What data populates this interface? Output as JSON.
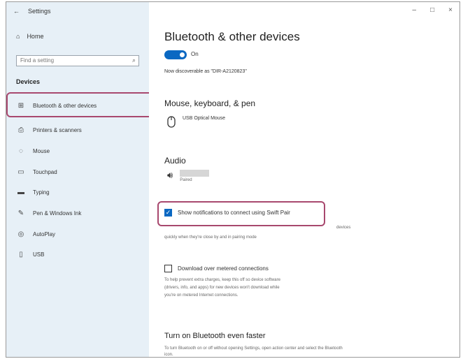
{
  "window": {
    "back_label": "←",
    "title": "Settings",
    "controls": {
      "minimize": "–",
      "maximize": "□",
      "close": "×"
    }
  },
  "sidebar": {
    "home_label": "Home",
    "search_placeholder": "Find a setting",
    "section_label": "Devices",
    "items": [
      {
        "label": "Bluetooth & other devices",
        "icon": "bluetooth-devices-icon",
        "glyph": "⊞"
      },
      {
        "label": "Printers & scanners",
        "icon": "printer-icon",
        "glyph": "⎙"
      },
      {
        "label": "Mouse",
        "icon": "mouse-icon",
        "glyph": "◌"
      },
      {
        "label": "Touchpad",
        "icon": "touchpad-icon",
        "glyph": "▭"
      },
      {
        "label": "Typing",
        "icon": "keyboard-icon",
        "glyph": "▬"
      },
      {
        "label": "Pen & Windows Ink",
        "icon": "pen-icon",
        "glyph": "✎"
      },
      {
        "label": "AutoPlay",
        "icon": "autoplay-icon",
        "glyph": "◎"
      },
      {
        "label": "USB",
        "icon": "usb-icon",
        "glyph": "▯"
      }
    ]
  },
  "main": {
    "title": "Bluetooth & other devices",
    "bluetooth_toggle": {
      "state_label": "On",
      "on": true
    },
    "discoverable_text": "Now discoverable as \"DIR-A2120823\"",
    "mouse_section": {
      "heading": "Mouse, keyboard, & pen",
      "device_name": "USB Optical Mouse"
    },
    "audio_section": {
      "heading": "Audio",
      "device_status": "Paired"
    },
    "swift_pair": {
      "label": "Show notifications to connect using Swift Pair",
      "checked": true,
      "trailing_text": "devices",
      "help_text": "quickly when they're close by and in pairing mode"
    },
    "metered": {
      "label": "Download over metered connections",
      "checked": false,
      "help_lines": [
        "To help prevent extra charges, keep this off so device software",
        "(drivers, info, and apps) for new devices won't download while",
        "you're on metered Internet connections."
      ]
    },
    "faster": {
      "heading": "Turn on Bluetooth even faster",
      "help_text": "To turn Bluetooth on or off without opening Settings, open action center and select the Bluetooth",
      "help_text_2": "icon."
    }
  },
  "colors": {
    "accent": "#0a68c2",
    "highlight_outline": "#a8486e",
    "sidebar_bg": "#e7f0f7"
  }
}
